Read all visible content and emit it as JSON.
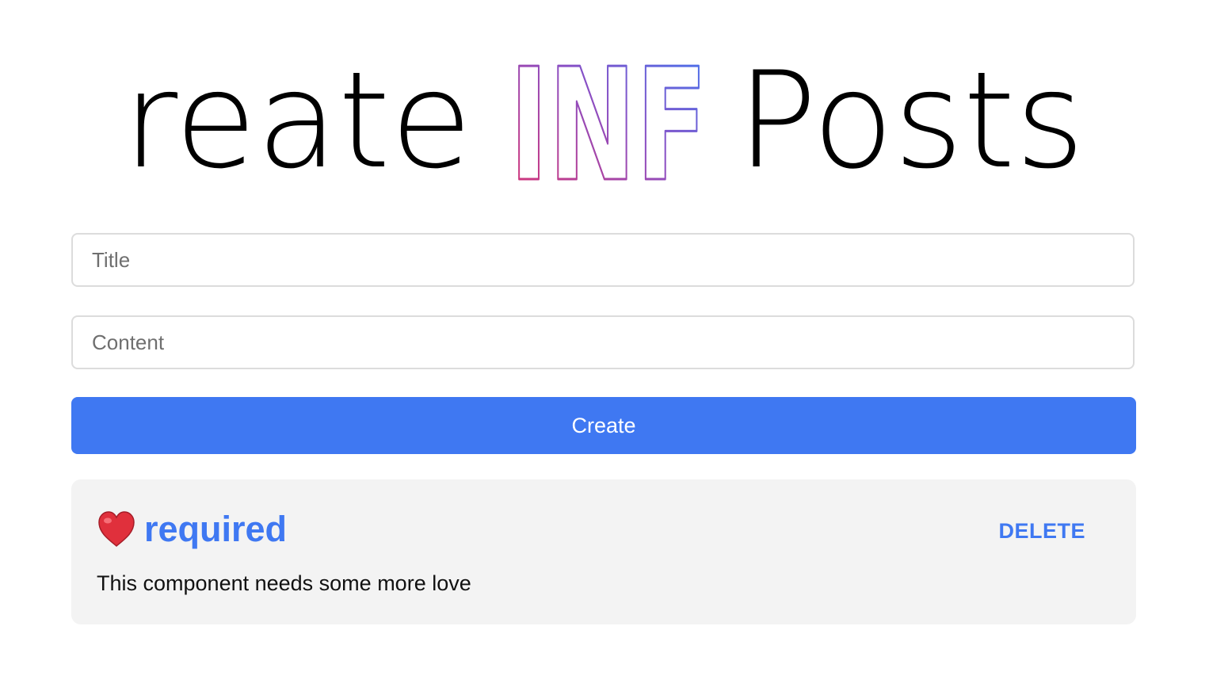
{
  "header": {
    "title_prefix": "Create",
    "title_highlight": "INF",
    "title_suffix": "Posts",
    "highlight_gradient": [
      "#e0306a",
      "#8a4fc4",
      "#3f78f2"
    ]
  },
  "form": {
    "title_placeholder": "Title",
    "title_value": "",
    "content_placeholder": "Content",
    "content_value": "",
    "create_label": "Create"
  },
  "posts": [
    {
      "icon": "heart-icon",
      "title": "required",
      "body": "This component needs some more love",
      "delete_label": "DELETE"
    }
  ],
  "colors": {
    "accent": "#3f78f2",
    "card_background": "#f3f3f3",
    "input_border": "#dcdcdc",
    "heart": "#e0303c"
  }
}
